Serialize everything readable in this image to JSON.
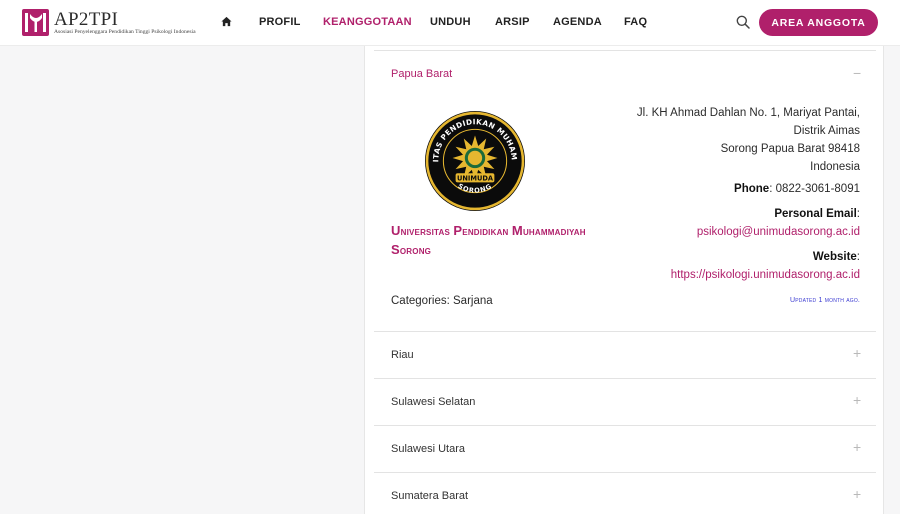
{
  "brand": {
    "title": "AP2TPI",
    "subtitle": "Asosiasi Penyelenggara Pendidikan Tinggi Psikologi Indonesia",
    "color": "#b0206b"
  },
  "nav": {
    "home_icon": "home-icon",
    "items": [
      {
        "label": "PROFIL",
        "active": false
      },
      {
        "label": "KEANGGOTAAN",
        "active": true
      },
      {
        "label": "UNDUH",
        "active": false
      },
      {
        "label": "ARSIP",
        "active": false
      },
      {
        "label": "AGENDA",
        "active": false
      },
      {
        "label": "FAQ",
        "active": false
      }
    ],
    "search_icon": "search-icon",
    "cta_label": "AREA ANGGOTA"
  },
  "accordion": {
    "open": {
      "title": "Papua Barat",
      "toggle": "−",
      "university": {
        "name_line1_first": "U",
        "name_line1_rest": "niversitas ",
        "name_line1_p2_first": "P",
        "name_line1_p2_rest": "endidikan ",
        "name_line1_p3_first": "M",
        "name_line1_p3_rest": "uhammadiyah",
        "name_line2_first": "S",
        "name_line2_rest": "orong",
        "logo_ring_text": "UNIVERSITAS PENDIDIKAN MUHAMMADIYAH",
        "logo_banner": "UNIMUDA",
        "logo_bottom": "SORONG"
      },
      "address": [
        "Jl. KH Ahmad Dahlan No. 1, Mariyat Pantai,",
        "Distrik Aimas",
        "Sorong Papua Barat 98418",
        "Indonesia"
      ],
      "phone_label": "Phone",
      "phone": ": 0822-3061-8091",
      "email_label": "Personal Email",
      "email": "psikologi@unimudasorong.ac.id",
      "website_label": "Website",
      "website": "https://psikologi.unimudasorong.ac.id",
      "colon": ":",
      "categories": "Categories: Sarjana",
      "updated": "Updated 1 month ago."
    },
    "collapsed": [
      {
        "title": "Riau",
        "toggle": "+"
      },
      {
        "title": "Sulawesi Selatan",
        "toggle": "+"
      },
      {
        "title": "Sulawesi Utara",
        "toggle": "+"
      },
      {
        "title": "Sumatera Barat",
        "toggle": "+"
      }
    ]
  }
}
